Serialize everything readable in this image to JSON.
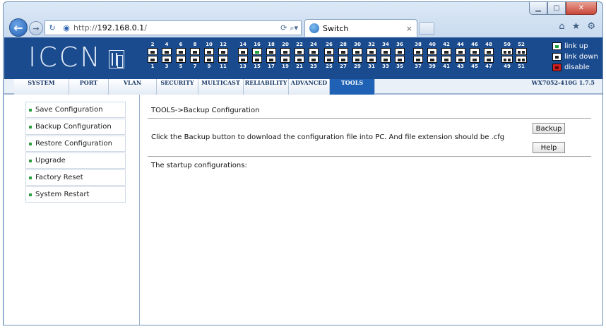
{
  "browser": {
    "url_prefix": "http://",
    "url_host": "192.168.0.1",
    "url_suffix": "/",
    "tab_title": "Switch",
    "tab_close": "×",
    "window_min": "▁",
    "window_max": "▢",
    "window_close": "✕"
  },
  "header": {
    "logo": "ICCN",
    "legend": [
      {
        "label": "link up"
      },
      {
        "label": "link down"
      },
      {
        "label": "disable"
      }
    ]
  },
  "ports": {
    "groups": [
      {
        "top": [
          "2",
          "4",
          "6",
          "8",
          "10",
          "12"
        ],
        "bottom": [
          "1",
          "3",
          "5",
          "7",
          "9",
          "11"
        ]
      },
      {
        "top": [
          "14",
          "16",
          "18",
          "20",
          "22",
          "24"
        ],
        "bottom": [
          "13",
          "15",
          "17",
          "19",
          "21",
          "23"
        ]
      },
      {
        "top": [
          "26",
          "28",
          "30",
          "32",
          "34",
          "36"
        ],
        "bottom": [
          "25",
          "27",
          "29",
          "31",
          "33",
          "35"
        ]
      },
      {
        "top": [
          "38",
          "40",
          "42",
          "44",
          "46",
          "48"
        ],
        "bottom": [
          "37",
          "39",
          "41",
          "43",
          "45",
          "47"
        ]
      },
      {
        "top": [
          "50",
          "52"
        ],
        "bottom": [
          "49",
          "51"
        ]
      }
    ],
    "link_up": [
      "16"
    ]
  },
  "menu": {
    "items": [
      "SYSTEM",
      "PORT",
      "VLAN",
      "SECURITY",
      "MULTICAST",
      "RELIABILITY",
      "ADVANCED",
      "TOOLS"
    ],
    "active": "TOOLS",
    "version": "WX7052-410G 1.7.5"
  },
  "sidebar": {
    "items": [
      {
        "label": "Save Configuration"
      },
      {
        "label": "Backup Configuration"
      },
      {
        "label": "Restore Configuration"
      },
      {
        "label": "Upgrade"
      },
      {
        "label": "Factory Reset"
      },
      {
        "label": "System Restart"
      }
    ]
  },
  "main": {
    "breadcrumb": "TOOLS->Backup Configuration",
    "message": "Click the Backup button to download the configuration file into PC. And file extension should be .cfg",
    "backup_button": "Backup",
    "help_button": "Help",
    "startup_label": "The startup configurations:"
  }
}
